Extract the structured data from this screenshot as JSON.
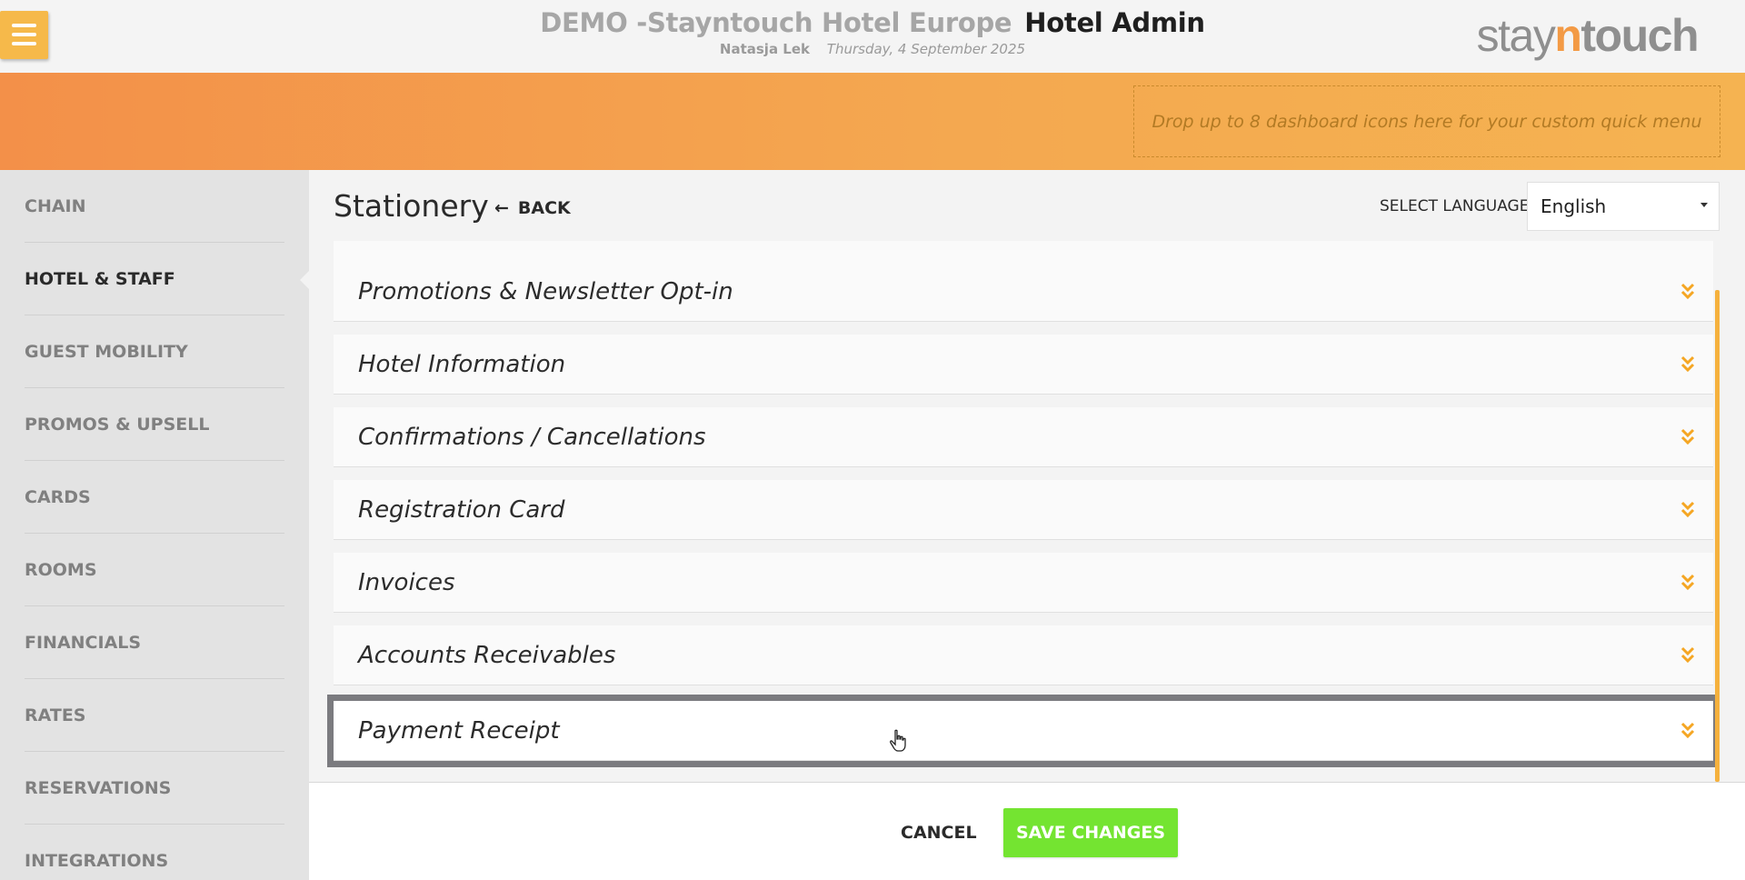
{
  "header": {
    "hotel_name": "DEMO -Stayntouch Hotel Europe",
    "app_name": "Hotel Admin",
    "user": "Natasja Lek",
    "date": "Thursday, 4 September 2025",
    "logo": {
      "part1": "stay",
      "part2": "n",
      "part3": "touch"
    },
    "menu_icon": "hamburger-icon"
  },
  "banner": {
    "dropzone_text": "Drop up to 8 dashboard icons here for your custom quick menu"
  },
  "sidebar": {
    "items": [
      {
        "label": "CHAIN",
        "active": false
      },
      {
        "label": "HOTEL & STAFF",
        "active": true
      },
      {
        "label": "GUEST MOBILITY",
        "active": false
      },
      {
        "label": "PROMOS & UPSELL",
        "active": false
      },
      {
        "label": "CARDS",
        "active": false
      },
      {
        "label": "ROOMS",
        "active": false
      },
      {
        "label": "FINANCIALS",
        "active": false
      },
      {
        "label": "RATES",
        "active": false
      },
      {
        "label": "RESERVATIONS",
        "active": false
      },
      {
        "label": "INTEGRATIONS",
        "active": false
      }
    ]
  },
  "main": {
    "title": "Stationery",
    "back_label": "BACK",
    "language_label": "SELECT LANGUAGE",
    "language_value": "English",
    "sections": [
      {
        "label": "Promotions & Newsletter Opt-in"
      },
      {
        "label": "Hotel Information"
      },
      {
        "label": "Confirmations / Cancellations"
      },
      {
        "label": "Registration Card"
      },
      {
        "label": "Invoices"
      },
      {
        "label": "Accounts Receivables"
      },
      {
        "label": "Payment Receipt",
        "highlighted": true
      }
    ],
    "expand_icon": "double-chevron-down-icon",
    "accent_color": "#f5a623"
  },
  "footer": {
    "cancel_label": "CANCEL",
    "save_label": "SAVE CHANGES",
    "save_color": "#74e431"
  }
}
